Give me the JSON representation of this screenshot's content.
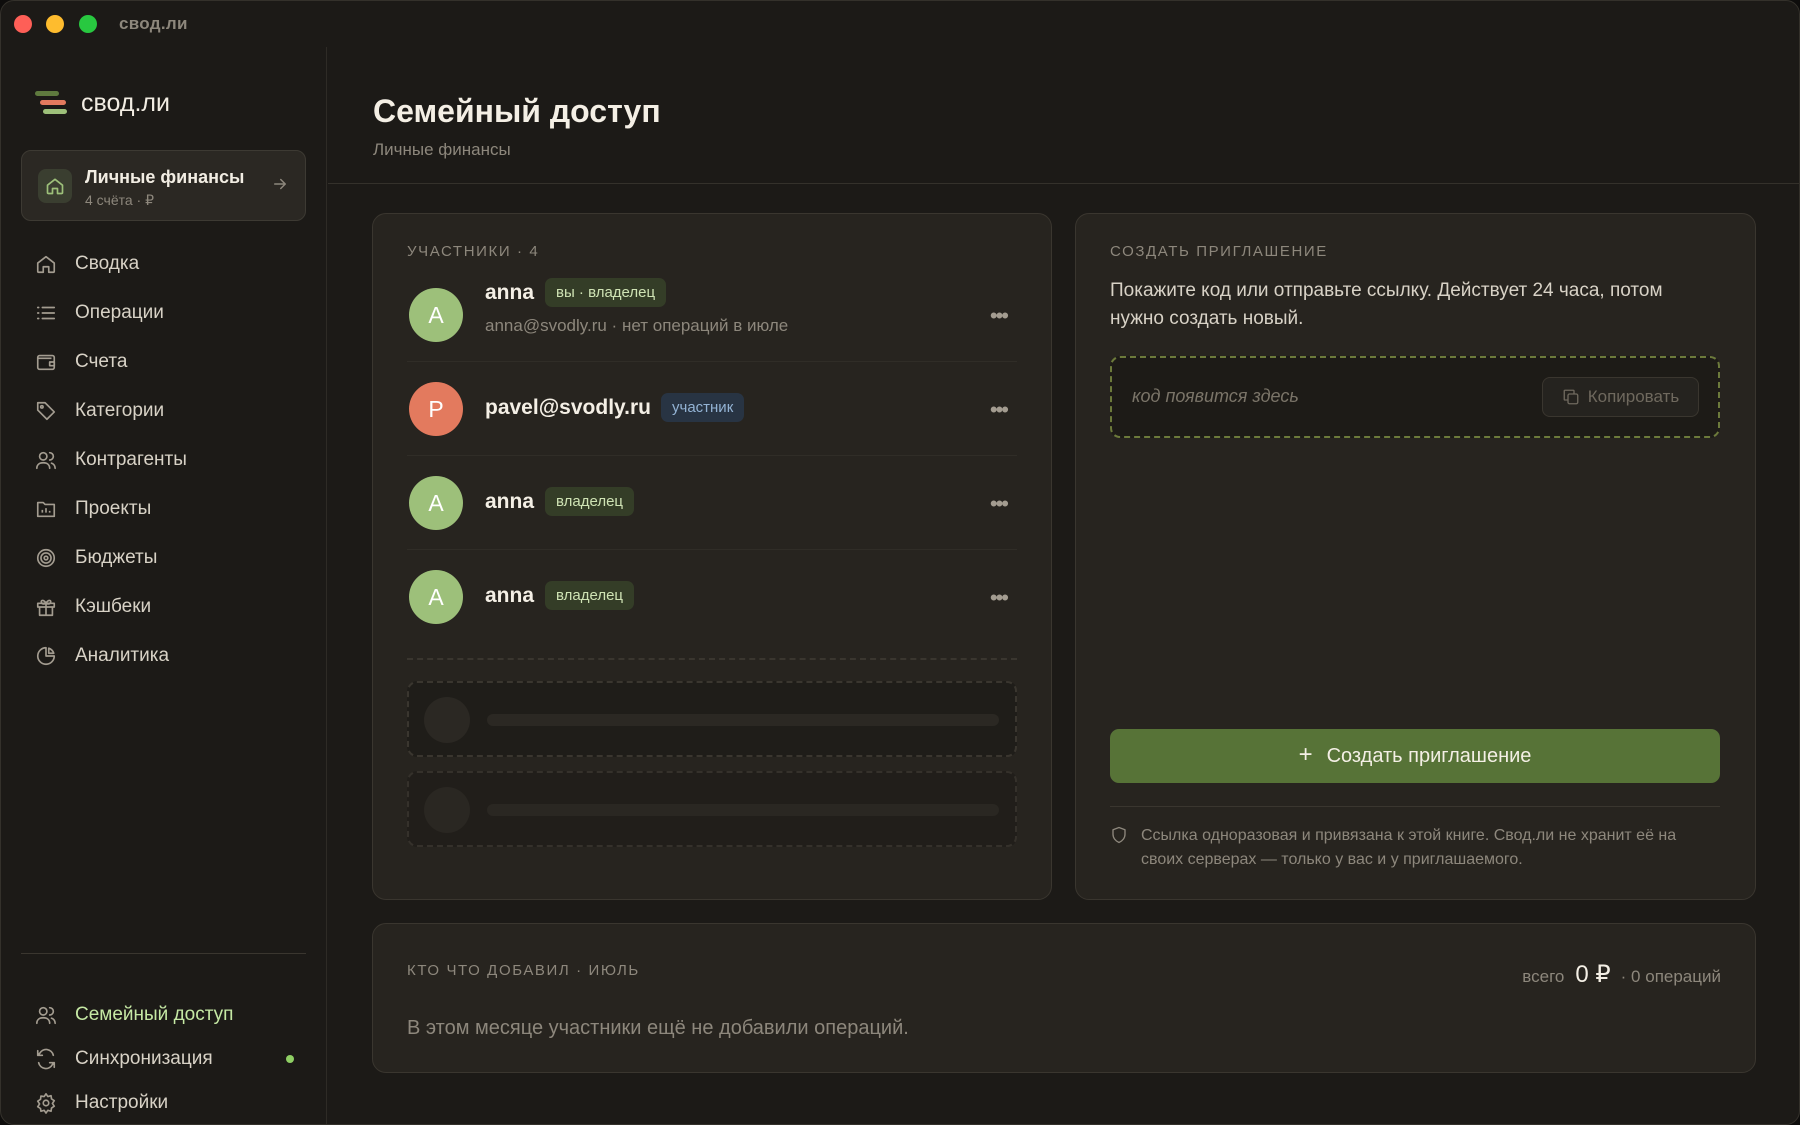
{
  "window": {
    "title": "свод.ли"
  },
  "sidebar": {
    "logo_text": "свод.ли",
    "book": {
      "title": "Личные финансы",
      "subtitle": "4 счёта · ₽"
    },
    "nav": [
      {
        "label": "Сводка",
        "icon": "home-icon"
      },
      {
        "label": "Операции",
        "icon": "list-icon"
      },
      {
        "label": "Счета",
        "icon": "wallet-icon"
      },
      {
        "label": "Категории",
        "icon": "tag-icon"
      },
      {
        "label": "Контрагенты",
        "icon": "users-icon"
      },
      {
        "label": "Проекты",
        "icon": "folder-chart-icon"
      },
      {
        "label": "Бюджеты",
        "icon": "target-icon"
      },
      {
        "label": "Кэшбеки",
        "icon": "gift-icon"
      },
      {
        "label": "Аналитика",
        "icon": "pie-chart-icon"
      }
    ],
    "bottom_nav": [
      {
        "label": "Семейный доступ",
        "icon": "users-icon",
        "active": true
      },
      {
        "label": "Синхронизация",
        "icon": "sync-icon",
        "status_dot": true
      },
      {
        "label": "Настройки",
        "icon": "gear-icon"
      }
    ]
  },
  "header": {
    "title": "Семейный доступ",
    "subtitle": "Личные финансы"
  },
  "members": {
    "heading": "УЧАСТНИКИ · 4",
    "list": [
      {
        "initial": "A",
        "name": "anna",
        "badge": "вы · владелец",
        "subtitle": "anna@svodly.ru · нет операций в июле"
      },
      {
        "initial": "P",
        "name": "pavel@svodly.ru",
        "badge": "участник"
      },
      {
        "initial": "A",
        "name": "anna",
        "badge": "владелец"
      },
      {
        "initial": "A",
        "name": "anna",
        "badge": "владелец"
      }
    ]
  },
  "invite": {
    "heading": "СОЗДАТЬ ПРИГЛАШЕНИЕ",
    "description": "Покажите код или отправьте ссылку. Действует 24 часа, потом нужно создать новый.",
    "code_placeholder": "код появится здесь",
    "copy_label": "Копировать",
    "create_label": "Создать приглашение",
    "note": "Ссылка одноразовая и привязана к этой книге. Свод.ли не хранит её на своих серверах — только у вас и у приглашаемого."
  },
  "activity": {
    "heading": "КТО ЧТО ДОБАВИЛ · ИЮЛЬ",
    "total_label": "всего",
    "total_value": "0 ₽",
    "total_ops": "· 0 операций",
    "empty_text": "В этом месяце участники ещё не добавили операций."
  },
  "colors": {
    "accent": "#577337",
    "avatar_green": "#9dc07a",
    "avatar_orange": "#e37a5e",
    "active_text": "#c5e8a4",
    "status_dot": "#8fcf64"
  }
}
